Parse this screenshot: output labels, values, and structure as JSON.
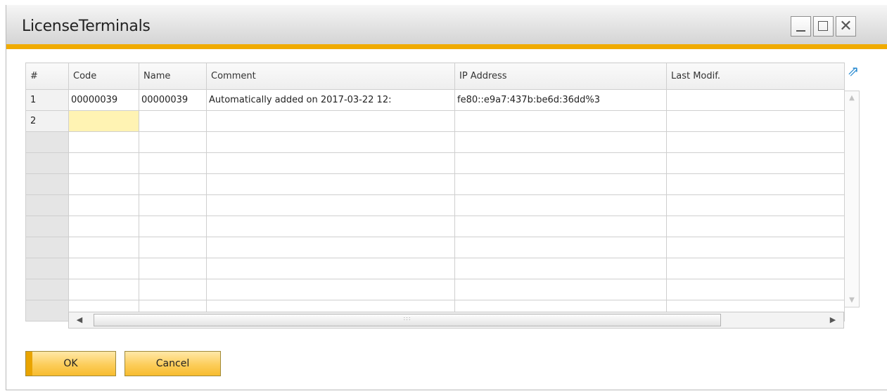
{
  "window": {
    "title": "LicenseTerminals",
    "controls": {
      "minimize": "_",
      "maximize": "☐",
      "close": "✕"
    },
    "accent_color": "#f0ab00"
  },
  "grid": {
    "columns": [
      "#",
      "Code",
      "Name",
      "Comment",
      "IP Address",
      "Last Modif."
    ],
    "rows": [
      {
        "num": "1",
        "code": "00000039",
        "name": "00000039",
        "comment": "Automatically added on 2017-03-22 12:",
        "ip": "fe80::e9a7:437b:be6d:36dd%3",
        "last_modif": ""
      },
      {
        "num": "2",
        "code": "",
        "name": "",
        "comment": "",
        "ip": "",
        "last_modif": ""
      }
    ],
    "blank_row_count": 9,
    "active_cell": "row 2, Code",
    "active_cell_color": "#fff3b3"
  },
  "icons": {
    "expand": "expand-arrow-icon",
    "scroll_up": "arrow-up-icon",
    "scroll_down": "arrow-down-icon",
    "scroll_left": "arrow-left-icon",
    "scroll_right": "arrow-right-icon",
    "grip": "grip-icon"
  },
  "buttons": {
    "ok": "OK",
    "cancel": "Cancel"
  }
}
